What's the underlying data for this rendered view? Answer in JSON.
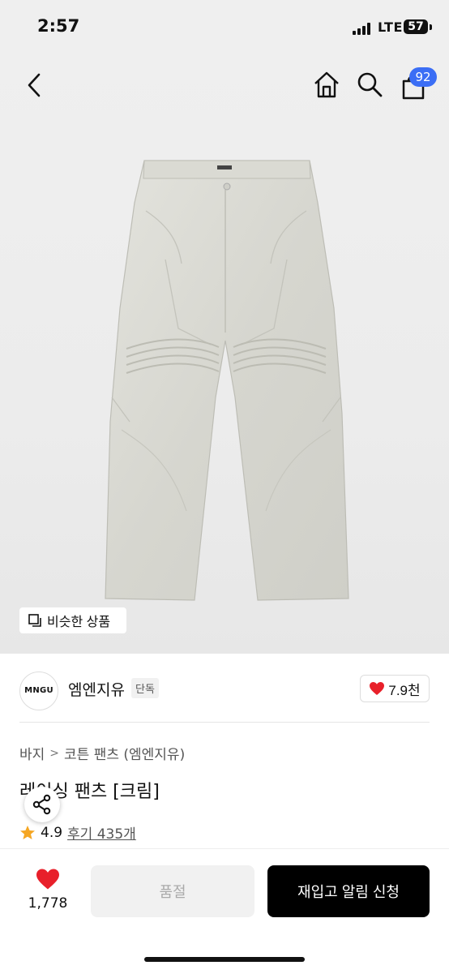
{
  "status_bar": {
    "time": "2:57",
    "network": "LTE",
    "battery": "57"
  },
  "nav": {
    "cart_count": "92"
  },
  "product_image": {
    "similar_label": "비슷한 상품"
  },
  "brand": {
    "logo_text": "MNGU",
    "name": "엠엔지유",
    "tag": "단독",
    "likes": "7.9천"
  },
  "breadcrumb": [
    "바지",
    "코튼 팬츠 (엠엔지유)"
  ],
  "product": {
    "title": "레이싱 팬츠 [크림]",
    "rating": "4.9",
    "review_link": "후기 435개"
  },
  "bottom_bar": {
    "fav_count": "1,778",
    "soldout_label": "품절",
    "restock_label": "재입고 알림 신청"
  },
  "colors": {
    "accent_red": "#e8202a",
    "badge_blue": "#3b6ef5",
    "star": "#f5a623",
    "pants": "#dcdcd6"
  },
  "icons": [
    "back-chevron-icon",
    "home-icon",
    "search-icon",
    "cart-icon",
    "similar-items-icon",
    "heart-icon",
    "share-icon",
    "star-icon"
  ]
}
